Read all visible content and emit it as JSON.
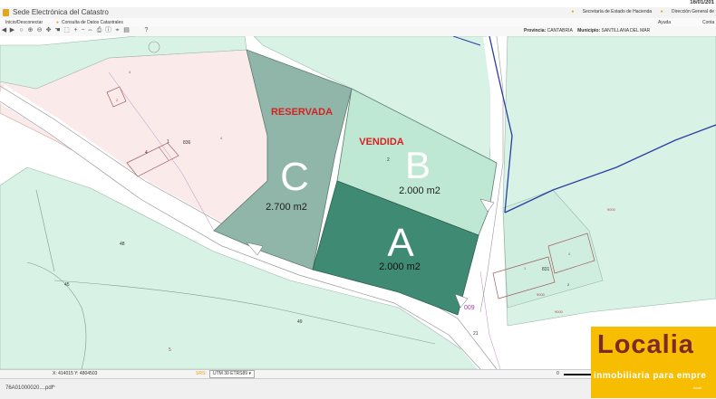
{
  "browser": {
    "date": "16/01/201"
  },
  "header": {
    "title": "Sede Electrónica del Catastro",
    "links": [
      "Secretaría de Estado de Hacienda",
      "Dirección General de"
    ]
  },
  "menu": {
    "items": [
      "Inicio/Desconectar",
      "Consulta de Datos Catastrales"
    ],
    "right_items": [
      "Ayuda",
      "Conta"
    ]
  },
  "toolbar": {
    "tools": [
      "arrow-left-icon",
      "arrow-right-icon",
      "zoom-icon",
      "zoom-in-icon",
      "zoom-out-icon",
      "pan-icon",
      "hand-icon",
      "select-icon",
      "plus-icon",
      "minus-icon",
      "fit-icon",
      "print-icon",
      "info-icon",
      "measure-icon",
      "layers-icon",
      "help-icon"
    ],
    "provincia_label": "Provincia:",
    "provincia_value": "CANTABRIA",
    "municipio_label": "Municipio:",
    "municipio_value": "SANTILLANA DEL MAR"
  },
  "map": {
    "parcels": {
      "A": {
        "letter": "A",
        "area": "2.000 m2",
        "color": "#3f8a72"
      },
      "B": {
        "letter": "B",
        "area": "2.000 m2",
        "color": "#bfe8d4"
      },
      "C": {
        "letter": "C",
        "area": "2.700 m2",
        "color": "#8fb6a8"
      }
    },
    "labels": {
      "reservada": "RESERVADA",
      "vendida": "VENDIDA",
      "num_2": "2",
      "num_836": "836",
      "num_4_upper": "4",
      "num_1_upper": "1",
      "num_48": "48",
      "num_45": "45",
      "num_49": "49",
      "num_5": "5",
      "num_21": "21",
      "num_009": "009",
      "num_831": "831",
      "num_1_right": "1",
      "num_4_right": "4",
      "num_2_right": "2",
      "tag_right1": "9000",
      "tag_right2": "9000",
      "tag_right3": "9000",
      "num_upper_a": "4",
      "num_upper_b": "4",
      "num_upper_c": "2"
    },
    "road_color": "#ffffff",
    "river_color": "#2a3fa0",
    "land_color": "#d9f2e6",
    "pink_color": "#fbeaea"
  },
  "status": {
    "coords": "X: 414015 Y: 4804503",
    "srs_label": "SRS:",
    "srs_value": "UTM 30 ETRS89",
    "scale_zero": "0"
  },
  "downloads": {
    "file": "76A01000020....pdf"
  },
  "brand": {
    "name": "Localia",
    "subtitle": "inmobiliaria para empre",
    "small": "locali"
  }
}
